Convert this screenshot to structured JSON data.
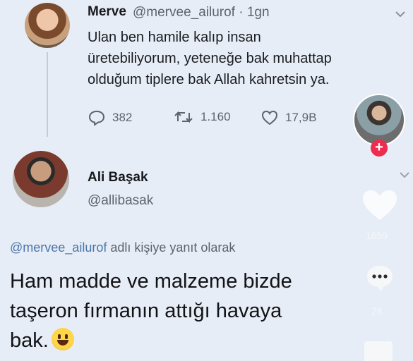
{
  "tweet1": {
    "name": "Merve",
    "handle_time": "@mervee_ailurof · 1gn",
    "lines": [
      "Ulan ben hamile kalıp insan",
      "üretebiliyorum, yeteneğe bak muhattap",
      "olduğum tiplere bak Allah kahretsin ya."
    ],
    "replies": "382",
    "retweets": "1.160",
    "likes": "17,9B"
  },
  "tweet2": {
    "name": "Ali Başak",
    "handle": "@allibasak",
    "reply_mention": "@mervee_ailurof",
    "reply_suffix": " adlı kişiye yanıt olarak",
    "lines": [
      "Ham madde ve malzeme bizde",
      "taşeron fırmanın attığı havaya",
      "bak."
    ]
  },
  "tiktok": {
    "likes": "1659",
    "comments": "28",
    "accent": "#ee2c50"
  },
  "icons": [
    "reply-icon",
    "retweet-icon",
    "like-icon",
    "chevron-down-icon",
    "heart-icon",
    "comment-icon",
    "plus-icon",
    "emoji-grin-icon"
  ]
}
